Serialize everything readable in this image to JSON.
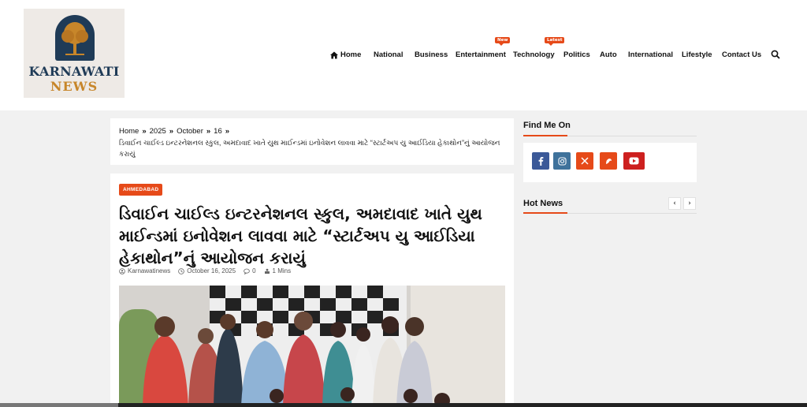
{
  "logo": {
    "line1": "KARNAWATI",
    "line2": "NEWS"
  },
  "nav": {
    "items": [
      {
        "label": "Home",
        "badge": ""
      },
      {
        "label": "National",
        "badge": ""
      },
      {
        "label": "Business",
        "badge": ""
      },
      {
        "label": "Entertainment",
        "badge": "New"
      },
      {
        "label": "Technology",
        "badge": "Latest"
      },
      {
        "label": "Politics",
        "badge": ""
      },
      {
        "label": "Auto",
        "badge": ""
      },
      {
        "label": "International",
        "badge": ""
      },
      {
        "label": "Lifestyle",
        "badge": ""
      },
      {
        "label": "Contact Us",
        "badge": ""
      }
    ],
    "search_icon": "search-icon"
  },
  "breadcrumb": {
    "home": "Home",
    "year": "2025",
    "month": "October",
    "day": "16",
    "separator": "»",
    "current": "ડિવાઈન ચાઈલ્ડ ઇન્ટરનેશનલ સ્કુલ, અમદાવાદ ખાતે યુથ માઈન્ડમાં ઇનોવેશન લાવવા માટે “સ્ટાર્ટઅપ યુ આઈડિયા હેકાથોન”નું આયોજન કરાયું"
  },
  "article": {
    "category": "AHMEDABAD",
    "title": "ડિવાઈન ચાઈલ્ડ ઇન્ટરનેશનલ સ્કુલ, અમદાવાદ ખાતે યુથ માઈન્ડમાં ઇનોવેશન લાવવા માટે “સ્ટાર્ટઅપ યુ આઈડિયા હેકાથોન”નું આયોજન કરાયું",
    "author": "Karnawatinews",
    "date": "October 16, 2025",
    "comments": "0",
    "read_time": "1 Mins"
  },
  "sidebar": {
    "find_me_on": "Find Me On",
    "hot_news": "Hot News",
    "social": [
      {
        "icon": "facebook-icon",
        "color": "#3b5998"
      },
      {
        "icon": "instagram-icon",
        "color": "#3f729b"
      },
      {
        "icon": "x-twitter-icon",
        "color": "#e64a19"
      },
      {
        "icon": "kooapp-icon",
        "color": "#e64a19"
      },
      {
        "icon": "youtube-icon",
        "color": "#cd201f"
      }
    ],
    "prev_label": "‹",
    "next_label": "›"
  },
  "colors": {
    "accent": "#e64a19",
    "navy": "#1f3b57",
    "gold": "#c7862a"
  }
}
